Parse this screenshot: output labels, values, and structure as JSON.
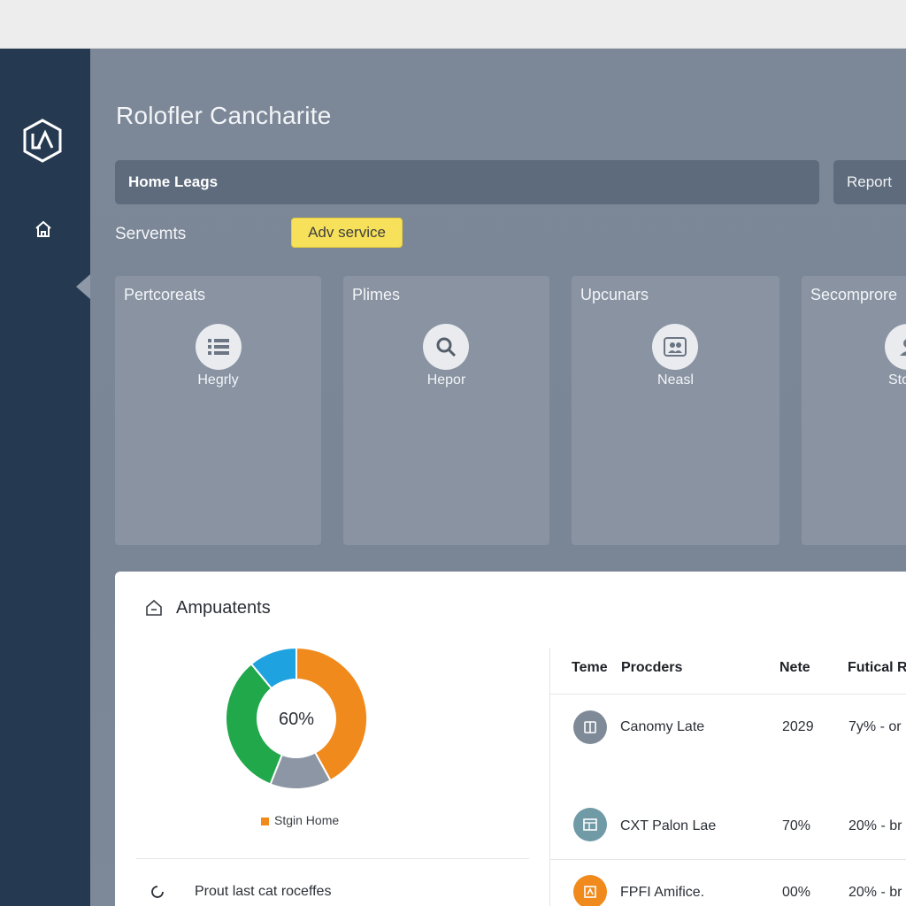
{
  "app": {
    "title": "Rolofler Cancharite"
  },
  "toolbar": {
    "search_value": "Home Leags",
    "report_label": "Report"
  },
  "services": {
    "label": "Servemts",
    "add_button": "Adv service",
    "cards": [
      {
        "title": "Pertcoreats",
        "subtitle": "Hegrly",
        "icon": "list-icon"
      },
      {
        "title": "Plimes",
        "subtitle": "Hepor",
        "icon": "search-icon"
      },
      {
        "title": "Upcunars",
        "subtitle": "Neasl",
        "icon": "users-icon"
      },
      {
        "title": "Secomprore",
        "subtitle": "Sto",
        "icon": "user-icon"
      }
    ]
  },
  "panel": {
    "title": "Ampuatents",
    "footer_text": "Prout last cat roceffes",
    "legend_label": "Stgin Home",
    "table": {
      "headers": [
        "Teme",
        "Procders",
        "Nete",
        "Futical R"
      ],
      "rows": [
        {
          "name": "Canomy Late",
          "value": "2029",
          "extra": "7y% - or",
          "icon": "document-icon",
          "icon_color": "#7f8a98"
        },
        {
          "name": "CXT Palon Lae",
          "value": "70%",
          "extra": "20% - br",
          "icon": "window-icon",
          "icon_color": "#6f9aa6"
        },
        {
          "name": "FPFI Amifice.",
          "value": "00%",
          "extra": "20% - br",
          "icon": "chart-icon",
          "icon_color": "#f08a1c"
        }
      ]
    }
  },
  "chart_data": {
    "type": "pie",
    "center_label": "60%",
    "legend": [
      "Stgin Home"
    ],
    "values": [
      42,
      14,
      33,
      11
    ],
    "colors": [
      "#f08a1c",
      "#8c96a4",
      "#21a84b",
      "#1fa3e0"
    ]
  },
  "colors": {
    "sidebar": "#253a51",
    "accent_yellow": "#f7e15a",
    "orange": "#f08a1c",
    "green": "#21a84b",
    "blue": "#1fa3e0"
  }
}
